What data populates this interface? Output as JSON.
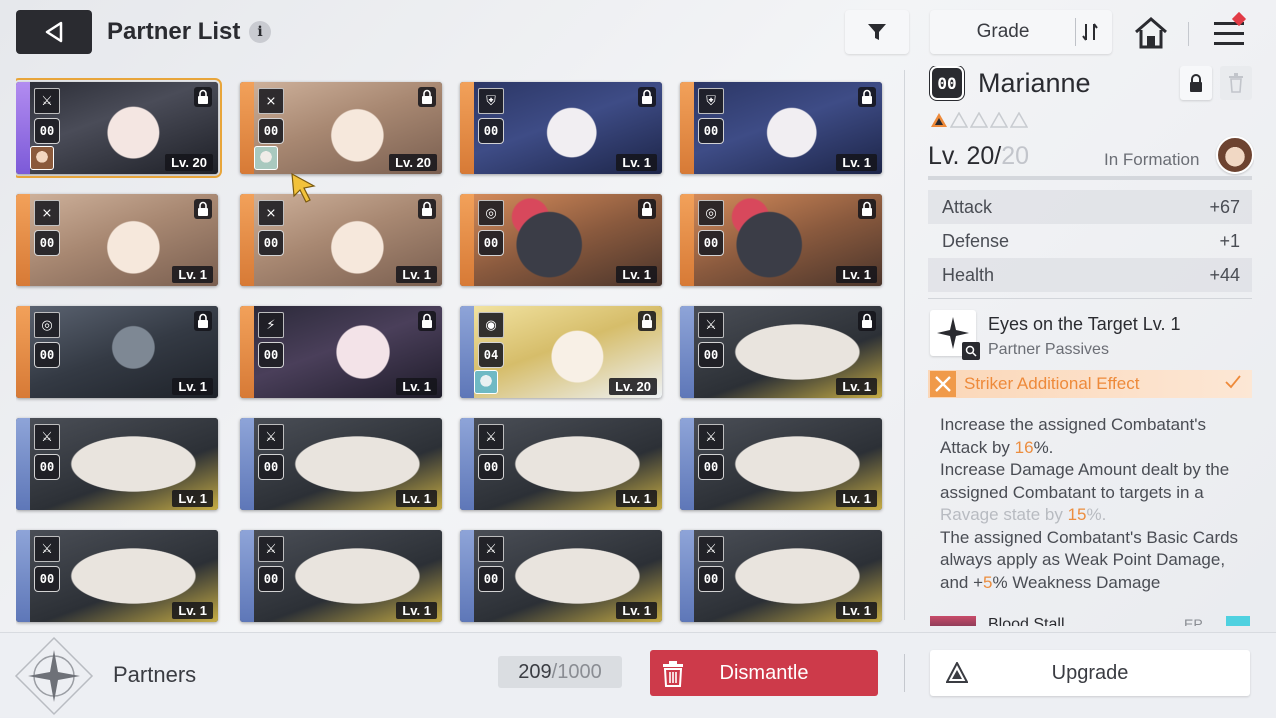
{
  "header": {
    "title": "Partner List",
    "info_glyph": "i",
    "grade_label": "Grade"
  },
  "icons": {
    "back": "back-triangle-icon",
    "filter": "funnel-icon",
    "sort": "sort-arrows-icon",
    "home": "home-icon",
    "menu": "hamburger-menu-icon"
  },
  "colors": {
    "accent_orange": "#ee8a3a",
    "dismantle_red": "#cd3a4a",
    "notif_red": "#e23b46",
    "selected_outline": "#e8a53a"
  },
  "cards": [
    {
      "type": "sword-cross",
      "num": "00",
      "level": "Lv. 20",
      "strip": "purple",
      "art": "girl-dark",
      "equip": "brown",
      "locked": true,
      "selected": true
    },
    {
      "type": "chevron-down",
      "num": "00",
      "level": "Lv. 20",
      "strip": "orange",
      "art": "girl-brown",
      "equip": "mint",
      "locked": true,
      "selected": false
    },
    {
      "type": "shield",
      "num": "00",
      "level": "Lv. 1",
      "strip": "orange",
      "art": "girl-navy",
      "equip": "",
      "locked": true,
      "selected": false
    },
    {
      "type": "shield",
      "num": "00",
      "level": "Lv. 1",
      "strip": "orange",
      "art": "girl-navy",
      "equip": "",
      "locked": true,
      "selected": false
    },
    {
      "type": "chevron-down",
      "num": "00",
      "level": "Lv. 1",
      "strip": "orange",
      "art": "girl-brown",
      "equip": "",
      "locked": true,
      "selected": false
    },
    {
      "type": "chevron-down",
      "num": "00",
      "level": "Lv. 1",
      "strip": "orange",
      "art": "girl-brown",
      "equip": "",
      "locked": true,
      "selected": false
    },
    {
      "type": "target",
      "num": "00",
      "level": "Lv. 1",
      "strip": "orange",
      "art": "creature",
      "equip": "",
      "locked": true,
      "selected": false
    },
    {
      "type": "target",
      "num": "00",
      "level": "Lv. 1",
      "strip": "orange",
      "art": "creature",
      "equip": "",
      "locked": true,
      "selected": false
    },
    {
      "type": "target",
      "num": "00",
      "level": "Lv. 1",
      "strip": "orange",
      "art": "mech",
      "equip": "",
      "locked": true,
      "selected": false
    },
    {
      "type": "bolt",
      "num": "00",
      "level": "Lv. 1",
      "strip": "orange",
      "art": "glasses",
      "equip": "",
      "locked": true,
      "selected": false
    },
    {
      "type": "circle-dot",
      "num": "04",
      "level": "Lv. 20",
      "strip": "blue",
      "art": "blonde",
      "equip": "teal",
      "locked": true,
      "selected": false
    },
    {
      "type": "sword-cross",
      "num": "00",
      "level": "Lv. 1",
      "strip": "blue",
      "art": "bird",
      "equip": "",
      "locked": true,
      "selected": false
    },
    {
      "type": "sword-cross",
      "num": "00",
      "level": "Lv. 1",
      "strip": "blue",
      "art": "bird",
      "equip": "",
      "locked": false,
      "selected": false
    },
    {
      "type": "sword-cross",
      "num": "00",
      "level": "Lv. 1",
      "strip": "blue",
      "art": "bird",
      "equip": "",
      "locked": false,
      "selected": false
    },
    {
      "type": "sword-cross",
      "num": "00",
      "level": "Lv. 1",
      "strip": "blue",
      "art": "bird",
      "equip": "",
      "locked": false,
      "selected": false
    },
    {
      "type": "sword-cross",
      "num": "00",
      "level": "Lv. 1",
      "strip": "blue",
      "art": "bird",
      "equip": "",
      "locked": false,
      "selected": false
    },
    {
      "type": "sword-cross",
      "num": "00",
      "level": "Lv. 1",
      "strip": "blue",
      "art": "bird",
      "equip": "",
      "locked": false,
      "selected": false
    },
    {
      "type": "sword-cross",
      "num": "00",
      "level": "Lv. 1",
      "strip": "blue",
      "art": "bird",
      "equip": "",
      "locked": false,
      "selected": false
    },
    {
      "type": "sword-cross",
      "num": "00",
      "level": "Lv. 1",
      "strip": "blue",
      "art": "bird",
      "equip": "",
      "locked": false,
      "selected": false
    },
    {
      "type": "sword-cross",
      "num": "00",
      "level": "Lv. 1",
      "strip": "blue",
      "art": "bird",
      "equip": "",
      "locked": false,
      "selected": false
    }
  ],
  "detail": {
    "num": "00",
    "name": "Marianne",
    "level_prefix": "Lv. 20/",
    "level_max": "20",
    "formation": "In Formation",
    "stats": [
      {
        "name": "Attack",
        "value": "+67"
      },
      {
        "name": "Defense",
        "value": "+1"
      },
      {
        "name": "Health",
        "value": "+44"
      }
    ],
    "skill_name": "Eyes on the Target Lv. 1",
    "skill_type": "Partner Passives",
    "effect_label": "Striker Additional Effect",
    "desc": {
      "p1a": "Increase the assigned Combatant's Attack by ",
      "p1v": "16",
      "p1b": "%.",
      "p2a": "Increase Damage Amount dealt by the assigned Combatant to targets in a ",
      "p2m": "Ravage state by ",
      "p2v": "15",
      "p2b": "%.",
      "p3a": "The assigned Combatant's Basic Cards always apply as Weak Point Damage, and +",
      "p3v": "5",
      "p3b": "% Weakness Damage"
    },
    "next_name": "Blood Stall",
    "next_tag": "EP"
  },
  "bottom": {
    "partners_label": "Partners",
    "count_current": "209",
    "count_sep": " / ",
    "count_max": "1000",
    "dismantle_label": "Dismantle",
    "upgrade_label": "Upgrade"
  }
}
